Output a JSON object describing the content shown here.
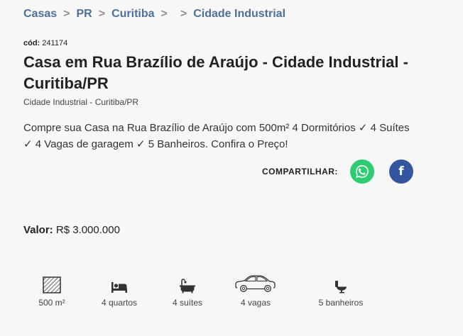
{
  "breadcrumb": {
    "items": [
      "Casas",
      "PR",
      "Curitiba",
      "",
      "Cidade Industrial"
    ],
    "separator": ">"
  },
  "listing": {
    "code_label": "cód:",
    "code_value": "241174",
    "title": "Casa em Rua Brazílio de Araújo - Cidade Industrial - Curitiba/PR",
    "subtitle": "Cidade Industrial - Curitiba/PR",
    "description": "Compre sua Casa na Rua Brazílio de Araújo com 500m² 4 Dormitórios ✓ 4 Suítes ✓ 4 Vagas de garagem ✓ 5 Banheiros. Confira o Preço!"
  },
  "share": {
    "label": "COMPARTILHAR:",
    "buttons": [
      {
        "icon": "whatsapp-icon",
        "color": "#2ecc71"
      },
      {
        "icon": "facebook-icon",
        "color": "#34569e",
        "glyph": "f"
      }
    ]
  },
  "price": {
    "label": "Valor:",
    "value": "R$ 3.000.000"
  },
  "features": [
    {
      "icon": "area-icon",
      "label": "500 m²"
    },
    {
      "icon": "bed-icon",
      "label": "4 quartos"
    },
    {
      "icon": "bathtub-icon",
      "label": "4 suítes"
    },
    {
      "icon": "car-icon",
      "label": "4 vagas"
    },
    {
      "icon": "toilet-icon",
      "label": "5 banheiros"
    }
  ]
}
